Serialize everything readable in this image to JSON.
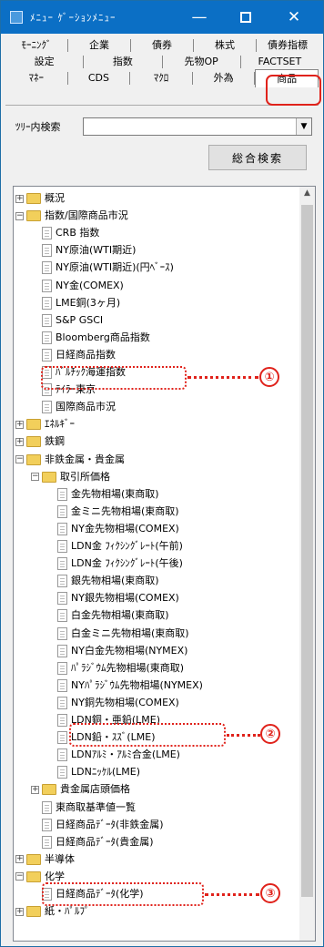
{
  "window": {
    "title": "ﾒﾆｭｰ ｹﾞｰｼｮﾝﾒﾆｭｰ"
  },
  "titlebar": {
    "minimize_glyph": "—",
    "close_glyph": "✕"
  },
  "tabs": {
    "rows": [
      [
        "ﾓｰﾆﾝｸﾞ",
        "企業",
        "債券",
        "株式",
        "債券指標"
      ],
      [
        "設定",
        "指数",
        "先物OP",
        "FACTSET"
      ],
      [
        "ﾏﾈｰ",
        "CDS",
        "ﾏｸﾛ",
        "外為",
        "商品"
      ]
    ],
    "active": "商品"
  },
  "search": {
    "label": "ﾂﾘｰ内検索",
    "value": "",
    "arrow": "▼",
    "button": "総合検索"
  },
  "tree": {
    "scroll_up": "▲",
    "nodes": [
      {
        "label": "概況",
        "type": "folder",
        "expander": "+",
        "level": 0
      },
      {
        "label": "指数/国際商品市況",
        "type": "folder",
        "expander": "−",
        "level": 0
      },
      {
        "label": "CRB 指数",
        "type": "doc",
        "level": 1
      },
      {
        "label": "NY原油(WTI期近)",
        "type": "doc",
        "level": 1
      },
      {
        "label": "NY原油(WTI期近)(円ﾍﾞｰｽ)",
        "type": "doc",
        "level": 1
      },
      {
        "label": "NY金(COMEX)",
        "type": "doc",
        "level": 1
      },
      {
        "label": "LME銅(3ヶ月)",
        "type": "doc",
        "level": 1
      },
      {
        "label": "S&P GSCI",
        "type": "doc",
        "level": 1
      },
      {
        "label": "Bloomberg商品指数",
        "type": "doc",
        "level": 1
      },
      {
        "label": "日経商品指数",
        "type": "doc",
        "level": 1
      },
      {
        "label": "ﾊﾞﾙﾁｯｸ海運指数",
        "type": "doc",
        "level": 1
      },
      {
        "label": "ﾃｲﾗｰ東京",
        "type": "doc",
        "level": 1
      },
      {
        "label": "国際商品市況",
        "type": "doc",
        "level": 1
      },
      {
        "label": "ｴﾈﾙｷﾞｰ",
        "type": "folder",
        "expander": "+",
        "level": 0
      },
      {
        "label": "鉄鋼",
        "type": "folder",
        "expander": "+",
        "level": 0
      },
      {
        "label": "非鉄金属・貴金属",
        "type": "folder",
        "expander": "−",
        "level": 0
      },
      {
        "label": "取引所価格",
        "type": "folder",
        "expander": "−",
        "level": 1
      },
      {
        "label": "金先物相場(東商取)",
        "type": "doc",
        "level": 2
      },
      {
        "label": "金ミニ先物相場(東商取)",
        "type": "doc",
        "level": 2
      },
      {
        "label": "NY金先物相場(COMEX)",
        "type": "doc",
        "level": 2
      },
      {
        "label": "LDN金 ﾌｨｸｼﾝｸﾞﾚｰﾄ(午前)",
        "type": "doc",
        "level": 2
      },
      {
        "label": "LDN金 ﾌｨｸｼﾝｸﾞﾚｰﾄ(午後)",
        "type": "doc",
        "level": 2
      },
      {
        "label": "銀先物相場(東商取)",
        "type": "doc",
        "level": 2
      },
      {
        "label": "NY銀先物相場(COMEX)",
        "type": "doc",
        "level": 2
      },
      {
        "label": "白金先物相場(東商取)",
        "type": "doc",
        "level": 2
      },
      {
        "label": "白金ミニ先物相場(東商取)",
        "type": "doc",
        "level": 2
      },
      {
        "label": "NY白金先物相場(NYMEX)",
        "type": "doc",
        "level": 2
      },
      {
        "label": "ﾊﾟﾗｼﾞｳﾑ先物相場(東商取)",
        "type": "doc",
        "level": 2
      },
      {
        "label": "NYﾊﾟﾗｼﾞｳﾑ先物相場(NYMEX)",
        "type": "doc",
        "level": 2
      },
      {
        "label": "NY銅先物相場(COMEX)",
        "type": "doc",
        "level": 2
      },
      {
        "label": "LDN銅・亜鉛(LME)",
        "type": "doc",
        "level": 2
      },
      {
        "label": "LDN鉛・ｽｽﾞ(LME)",
        "type": "doc",
        "level": 2
      },
      {
        "label": "LDNｱﾙﾐ・ｱﾙﾐ合金(LME)",
        "type": "doc",
        "level": 2
      },
      {
        "label": "LDNﾆｯｹﾙ(LME)",
        "type": "doc",
        "level": 2
      },
      {
        "label": "貴金属店頭価格",
        "type": "folder",
        "expander": "+",
        "level": 1
      },
      {
        "label": "東商取基準値一覧",
        "type": "doc",
        "level": 1
      },
      {
        "label": "日経商品ﾃﾞｰﾀ(非鉄金属)",
        "type": "doc",
        "level": 1
      },
      {
        "label": "日経商品ﾃﾞｰﾀ(貴金属)",
        "type": "doc",
        "level": 1
      },
      {
        "label": "半導体",
        "type": "folder",
        "expander": "+",
        "level": 0
      },
      {
        "label": "化学",
        "type": "folder",
        "expander": "−",
        "level": 0
      },
      {
        "label": "日経商品ﾃﾞｰﾀ(化学)",
        "type": "doc",
        "level": 1
      },
      {
        "label": "紙・ﾊﾟﾙﾌﾟ",
        "type": "folder",
        "expander": "+",
        "level": 0
      }
    ]
  },
  "annotations": {
    "callouts": [
      "①",
      "②",
      "③"
    ],
    "accent_color": "#e0221b"
  }
}
